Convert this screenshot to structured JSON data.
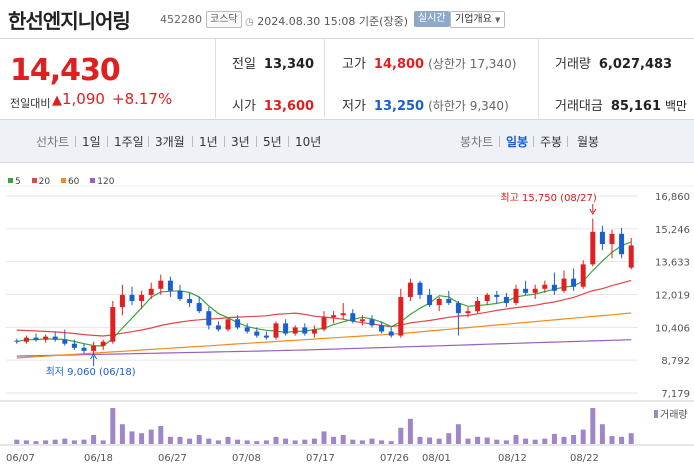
{
  "header": {
    "name": "한선엔지니어링",
    "code": "452280",
    "market": "코스닥",
    "datetime": "2024.08.30 15:08",
    "basis": "기준(장중)",
    "realtime": "실시간",
    "company_info": "기업개요"
  },
  "price": {
    "current": "14,430",
    "change_label": "전일대비",
    "change_value": "1,090",
    "change_pct": "+8.17%"
  },
  "stats": {
    "prev_close": {
      "label": "전일",
      "value": "13,340"
    },
    "open": {
      "label": "시가",
      "value": "13,600"
    },
    "high": {
      "label": "고가",
      "value": "14,800",
      "sub": "(상한가 17,340)"
    },
    "low": {
      "label": "저가",
      "value": "13,250",
      "sub": "(하한가 9,340)"
    },
    "volume": {
      "label": "거래량",
      "value": "6,027,483"
    },
    "amount": {
      "label": "거래대금",
      "value": "85,161",
      "unit": "백만"
    }
  },
  "toolbar": {
    "line_chart": "선차트",
    "periods": [
      "1일",
      "1주일",
      "3개월",
      "1년",
      "3년",
      "5년",
      "10년"
    ],
    "candle_chart": "봉차트",
    "candle_periods": [
      "일봉",
      "주봉",
      "월봉"
    ],
    "selected_candle": "일봉"
  },
  "legend": [
    {
      "label": "5",
      "color": "#3aa53a"
    },
    {
      "label": "20",
      "color": "#e04848"
    },
    {
      "label": "60",
      "color": "#f08c1e"
    },
    {
      "label": "120",
      "color": "#9b5fc0"
    }
  ],
  "volume_label": "거래량",
  "annotations": {
    "high": "최고 15,750 (08/27)",
    "low": "최저 9,060 (06/18)"
  },
  "chart_data": {
    "type": "candlestick",
    "y_ticks": [
      16860,
      15246,
      13633,
      12019,
      10406,
      8792,
      7179
    ],
    "ylim": [
      7179,
      16860
    ],
    "x_ticks": [
      "06/07",
      "06/18",
      "06/27",
      "07/08",
      "07/17",
      "07/26",
      "08/01",
      "08/12",
      "08/22"
    ],
    "candles": [
      [
        9750,
        9850,
        9600,
        9700
      ],
      [
        9700,
        10000,
        9600,
        9900
      ],
      [
        9900,
        10100,
        9700,
        9800
      ],
      [
        9800,
        10050,
        9650,
        9950
      ],
      [
        9950,
        10200,
        9700,
        9800
      ],
      [
        9800,
        10300,
        9500,
        9600
      ],
      [
        9600,
        9800,
        9300,
        9400
      ],
      [
        9400,
        9600,
        9100,
        9250
      ],
      [
        9250,
        9700,
        9060,
        9500
      ],
      [
        9500,
        9800,
        9300,
        9700
      ],
      [
        9700,
        11700,
        9600,
        11400
      ],
      [
        11400,
        12500,
        11000,
        12000
      ],
      [
        12000,
        12400,
        11500,
        11700
      ],
      [
        11700,
        12200,
        11300,
        12000
      ],
      [
        12000,
        12600,
        11800,
        12300
      ],
      [
        12300,
        13000,
        12000,
        12700
      ],
      [
        12700,
        12900,
        11900,
        12200
      ],
      [
        12200,
        12500,
        11700,
        11800
      ],
      [
        11800,
        12100,
        11400,
        11600
      ],
      [
        11600,
        11900,
        11100,
        11200
      ],
      [
        11200,
        11400,
        10300,
        10500
      ],
      [
        10500,
        10700,
        10200,
        10300
      ],
      [
        10300,
        10900,
        10200,
        10800
      ],
      [
        10800,
        11000,
        10300,
        10400
      ],
      [
        10400,
        10600,
        10100,
        10200
      ],
      [
        10200,
        10400,
        9900,
        10000
      ],
      [
        10000,
        10200,
        9800,
        9900
      ],
      [
        9900,
        10700,
        9800,
        10600
      ],
      [
        10600,
        10800,
        10000,
        10100
      ],
      [
        10100,
        10500,
        10000,
        10400
      ],
      [
        10400,
        10600,
        10000,
        10100
      ],
      [
        10100,
        10500,
        9900,
        10300
      ],
      [
        10300,
        11200,
        10200,
        10900
      ],
      [
        10900,
        11200,
        10600,
        11000
      ],
      [
        11000,
        11600,
        10800,
        11100
      ],
      [
        11100,
        11300,
        10600,
        10700
      ],
      [
        10700,
        11000,
        10500,
        10800
      ],
      [
        10800,
        11000,
        10400,
        10500
      ],
      [
        10500,
        10700,
        10100,
        10200
      ],
      [
        10200,
        10400,
        9900,
        10000
      ],
      [
        10000,
        12300,
        9900,
        11900
      ],
      [
        11900,
        12800,
        11700,
        12600
      ],
      [
        12600,
        12700,
        11800,
        12000
      ],
      [
        12000,
        12300,
        11400,
        11500
      ],
      [
        11500,
        11900,
        11200,
        11800
      ],
      [
        11800,
        12200,
        11500,
        11600
      ],
      [
        11600,
        11700,
        10000,
        11100
      ],
      [
        11100,
        11400,
        10900,
        11200
      ],
      [
        11200,
        11900,
        11100,
        11700
      ],
      [
        11700,
        12100,
        11500,
        12000
      ],
      [
        12000,
        12200,
        11600,
        11900
      ],
      [
        11900,
        12100,
        11400,
        11600
      ],
      [
        11600,
        12500,
        11500,
        12300
      ],
      [
        12300,
        12700,
        12000,
        12100
      ],
      [
        12100,
        12500,
        11800,
        12300
      ],
      [
        12300,
        12700,
        12100,
        12500
      ],
      [
        12500,
        13100,
        12000,
        12200
      ],
      [
        12200,
        13200,
        12100,
        12800
      ],
      [
        12800,
        13300,
        12200,
        12400
      ],
      [
        12400,
        13700,
        12300,
        13500
      ],
      [
        13500,
        15750,
        13400,
        15100
      ],
      [
        15100,
        15400,
        14200,
        14500
      ],
      [
        14500,
        15200,
        13800,
        15000
      ],
      [
        15000,
        15300,
        13800,
        14000
      ],
      [
        13340,
        14800,
        13250,
        14430
      ]
    ],
    "ma5_color": "#3aa53a",
    "ma20_color": "#e04848",
    "ma60_color": "#f08c1e",
    "ma120_color": "#9b5fc0",
    "volume_relative": [
      0.12,
      0.1,
      0.08,
      0.1,
      0.12,
      0.15,
      0.1,
      0.12,
      0.25,
      0.1,
      1.0,
      0.55,
      0.35,
      0.3,
      0.4,
      0.5,
      0.2,
      0.2,
      0.15,
      0.25,
      0.15,
      0.1,
      0.2,
      0.12,
      0.1,
      0.08,
      0.1,
      0.2,
      0.15,
      0.1,
      0.12,
      0.15,
      0.35,
      0.2,
      0.25,
      0.12,
      0.1,
      0.15,
      0.1,
      0.08,
      0.45,
      0.7,
      0.2,
      0.18,
      0.15,
      0.3,
      0.55,
      0.15,
      0.2,
      0.18,
      0.12,
      0.1,
      0.25,
      0.15,
      0.12,
      0.15,
      0.28,
      0.2,
      0.25,
      0.4,
      1.0,
      0.55,
      0.22,
      0.2,
      0.3
    ]
  }
}
